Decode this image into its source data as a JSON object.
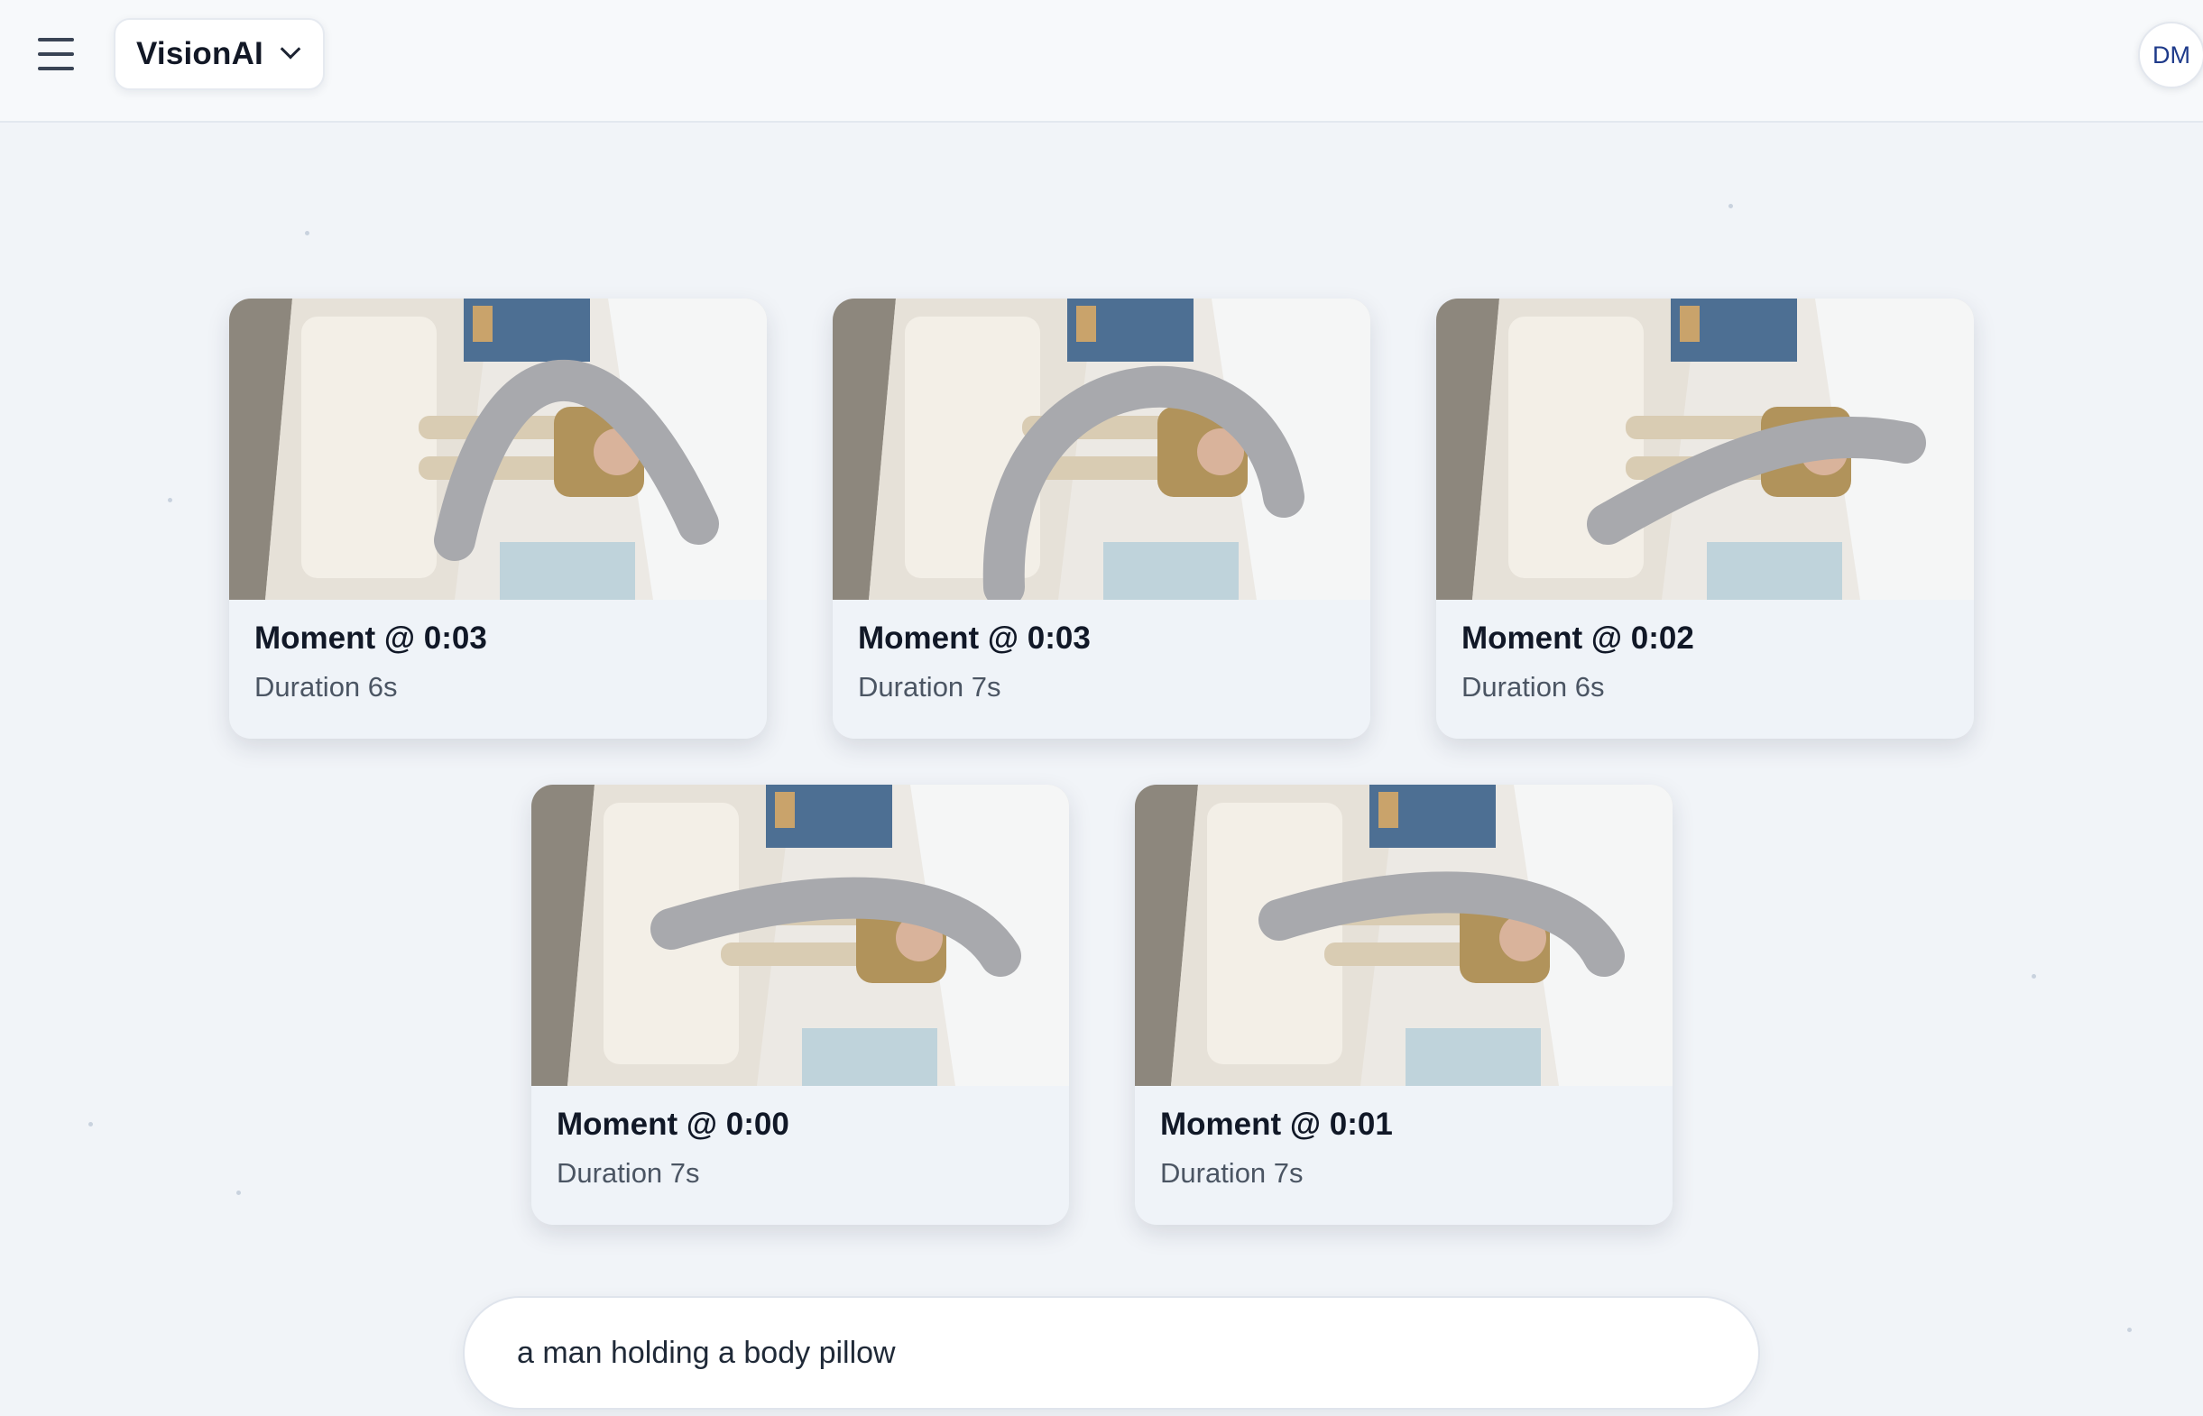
{
  "header": {
    "app_name": "VisionAI",
    "menu_icon": "hamburger-menu-icon",
    "dropdown_icon": "chevron-down-icon",
    "avatar_initials": "DM"
  },
  "results": [
    {
      "title": "Moment @ 0:03",
      "duration": "Duration 6s"
    },
    {
      "title": "Moment @ 0:03",
      "duration": "Duration 7s"
    },
    {
      "title": "Moment @ 0:02",
      "duration": "Duration 6s"
    },
    {
      "title": "Moment @ 0:00",
      "duration": "Duration 7s"
    },
    {
      "title": "Moment @ 0:01",
      "duration": "Duration 7s"
    }
  ],
  "search": {
    "query": "a man holding a body pillow"
  },
  "colors": {
    "background": "#f1f4f8",
    "card": "#eff3f8",
    "avatar_text": "#1e3a8a"
  }
}
